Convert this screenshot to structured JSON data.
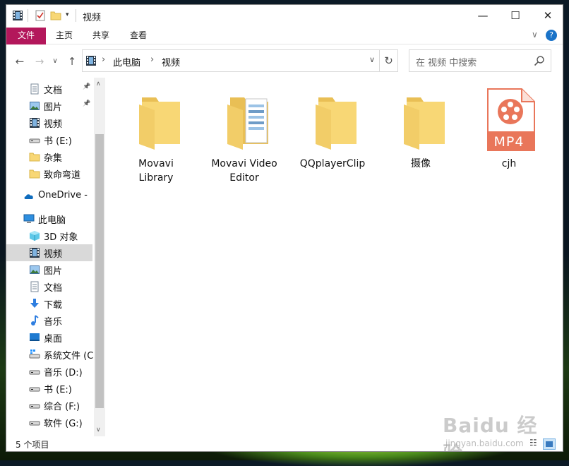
{
  "window": {
    "title": "视频",
    "controls": {
      "minimize": "—",
      "maximize": "☐",
      "close": "✕"
    }
  },
  "ribbon": {
    "tabs": [
      {
        "label": "文件"
      },
      {
        "label": "主页"
      },
      {
        "label": "共享"
      },
      {
        "label": "查看"
      }
    ],
    "expand_glyph": "∨",
    "help_glyph": "?"
  },
  "address_bar": {
    "breadcrumbs": [
      "此电脑",
      "视频"
    ],
    "search_placeholder": "在 视频 中搜索"
  },
  "navigation_pane": {
    "items": [
      {
        "label": "文档",
        "icon": "document-icon",
        "pinned": true
      },
      {
        "label": "图片",
        "icon": "picture-icon",
        "pinned": true
      },
      {
        "label": "视频",
        "icon": "video-icon",
        "pinned": false
      },
      {
        "label": "书 (E:)",
        "icon": "drive-icon",
        "pinned": false
      },
      {
        "label": "杂集",
        "icon": "folder-icon",
        "pinned": false
      },
      {
        "label": "致命弯道",
        "icon": "folder-icon",
        "pinned": false
      },
      {
        "label": "OneDrive -",
        "icon": "onedrive-icon",
        "pinned": false
      },
      {
        "label": "此电脑",
        "icon": "computer-icon",
        "pinned": false
      },
      {
        "label": "3D 对象",
        "icon": "cube-icon",
        "pinned": false
      },
      {
        "label": "视频",
        "icon": "video-icon",
        "pinned": false,
        "selected": true
      },
      {
        "label": "图片",
        "icon": "picture-icon",
        "pinned": false
      },
      {
        "label": "文档",
        "icon": "document-icon",
        "pinned": false
      },
      {
        "label": "下载",
        "icon": "download-icon",
        "pinned": false
      },
      {
        "label": "音乐",
        "icon": "music-icon",
        "pinned": false
      },
      {
        "label": "桌面",
        "icon": "desktop-icon",
        "pinned": false
      },
      {
        "label": "系统文件 (C",
        "icon": "system-drive-icon",
        "pinned": false
      },
      {
        "label": "音乐 (D:)",
        "icon": "drive-icon",
        "pinned": false
      },
      {
        "label": "书 (E:)",
        "icon": "drive-icon",
        "pinned": false
      },
      {
        "label": "综合 (F:)",
        "icon": "drive-icon",
        "pinned": false
      },
      {
        "label": "软件 (G:)",
        "icon": "drive-icon",
        "pinned": false
      }
    ]
  },
  "files": [
    {
      "name": "Movavi\nLibrary",
      "type": "folder"
    },
    {
      "name": "Movavi Video\nEditor",
      "type": "folder-with-docs"
    },
    {
      "name": "QQplayerClip",
      "type": "folder"
    },
    {
      "name": "摄像",
      "type": "folder"
    },
    {
      "name": "cjh",
      "type": "mp4",
      "badge": "MP4"
    }
  ],
  "status_bar": {
    "item_count": "5 个项目"
  },
  "watermark": {
    "main": "Baidu 经验",
    "sub": "jingyan.baidu.com"
  },
  "colors": {
    "file_tab": "#b3175b",
    "folder": "#f8d775",
    "mp4_accent": "#e9765a"
  }
}
